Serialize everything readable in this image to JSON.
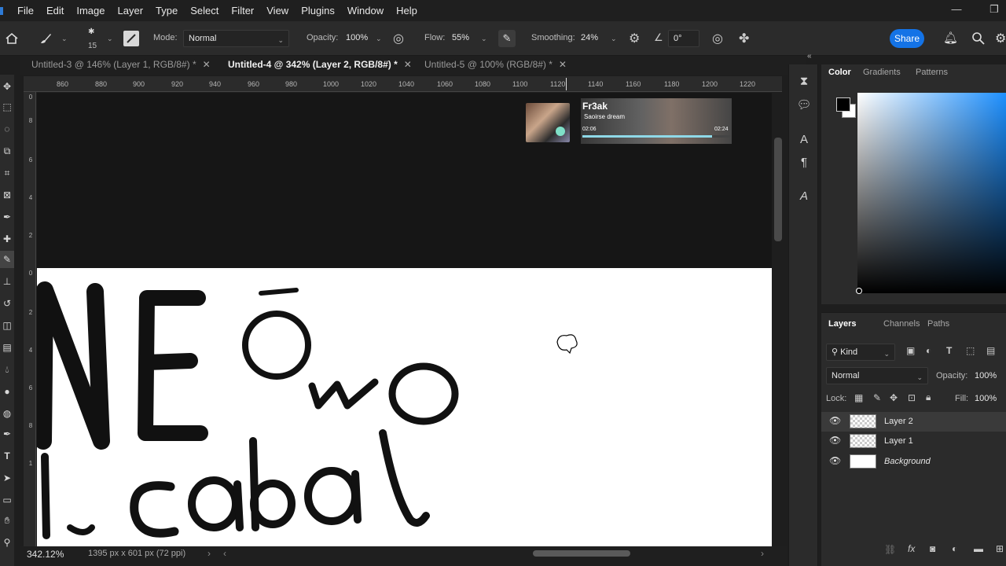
{
  "menubar": {
    "items": [
      "File",
      "Edit",
      "Image",
      "Layer",
      "Type",
      "Select",
      "Filter",
      "View",
      "Plugins",
      "Window",
      "Help"
    ]
  },
  "options_bar": {
    "brush_size": "15",
    "mode_label": "Mode:",
    "mode_value": "Normal",
    "opacity_label": "Opacity:",
    "opacity_value": "100%",
    "flow_label": "Flow:",
    "flow_value": "55%",
    "smoothing_label": "Smoothing:",
    "smoothing_value": "24%",
    "angle_value": "0°",
    "share_label": "Share"
  },
  "tabs": [
    {
      "label": "Untitled-3 @ 146% (Layer 1, RGB/8#) *",
      "active": false
    },
    {
      "label": "Untitled-4 @ 342% (Layer 2, RGB/8#) *",
      "active": true
    },
    {
      "label": "Untitled-5 @ 100% (RGB/8#) *",
      "active": false
    }
  ],
  "ruler_top": [
    "860",
    "880",
    "900",
    "920",
    "940",
    "960",
    "980",
    "1000",
    "1020",
    "1040",
    "1060",
    "1080",
    "1100",
    "1120",
    "1140",
    "1160",
    "1180",
    "1200",
    "1220"
  ],
  "ruler_left": [
    "0",
    "8",
    "6",
    "4",
    "2",
    "0",
    "2",
    "4",
    "6",
    "8",
    "1"
  ],
  "media_overlay": {
    "title": "Fr3ak",
    "subtitle": "Saoirse dream",
    "time_elapsed": "02:06",
    "time_total": "02:24",
    "progress": 0.875
  },
  "canvas_text": {
    "line1": "NE ōwo",
    "line2": "l cabal"
  },
  "color_panel": {
    "tabs": [
      "Color",
      "Gradients",
      "Patterns"
    ],
    "active_tab": "Color",
    "foreground": "#000000",
    "background": "#ffffff",
    "hue_color": "#1e90ff"
  },
  "layers_panel": {
    "tabs": [
      "Layers",
      "Channels",
      "Paths"
    ],
    "kind_label": "Kind",
    "blend_mode": "Normal",
    "opacity_label": "Opacity:",
    "opacity_value": "100%",
    "lock_label": "Lock:",
    "fill_label": "Fill:",
    "fill_value": "100%",
    "layers": [
      {
        "name": "Layer 2",
        "selected": true
      },
      {
        "name": "Layer 1",
        "selected": false
      },
      {
        "name": "Background",
        "selected": false
      }
    ]
  },
  "status_bar": {
    "zoom": "342.12%",
    "doc_info": "1395 px x 601 px (72 ppi)"
  }
}
